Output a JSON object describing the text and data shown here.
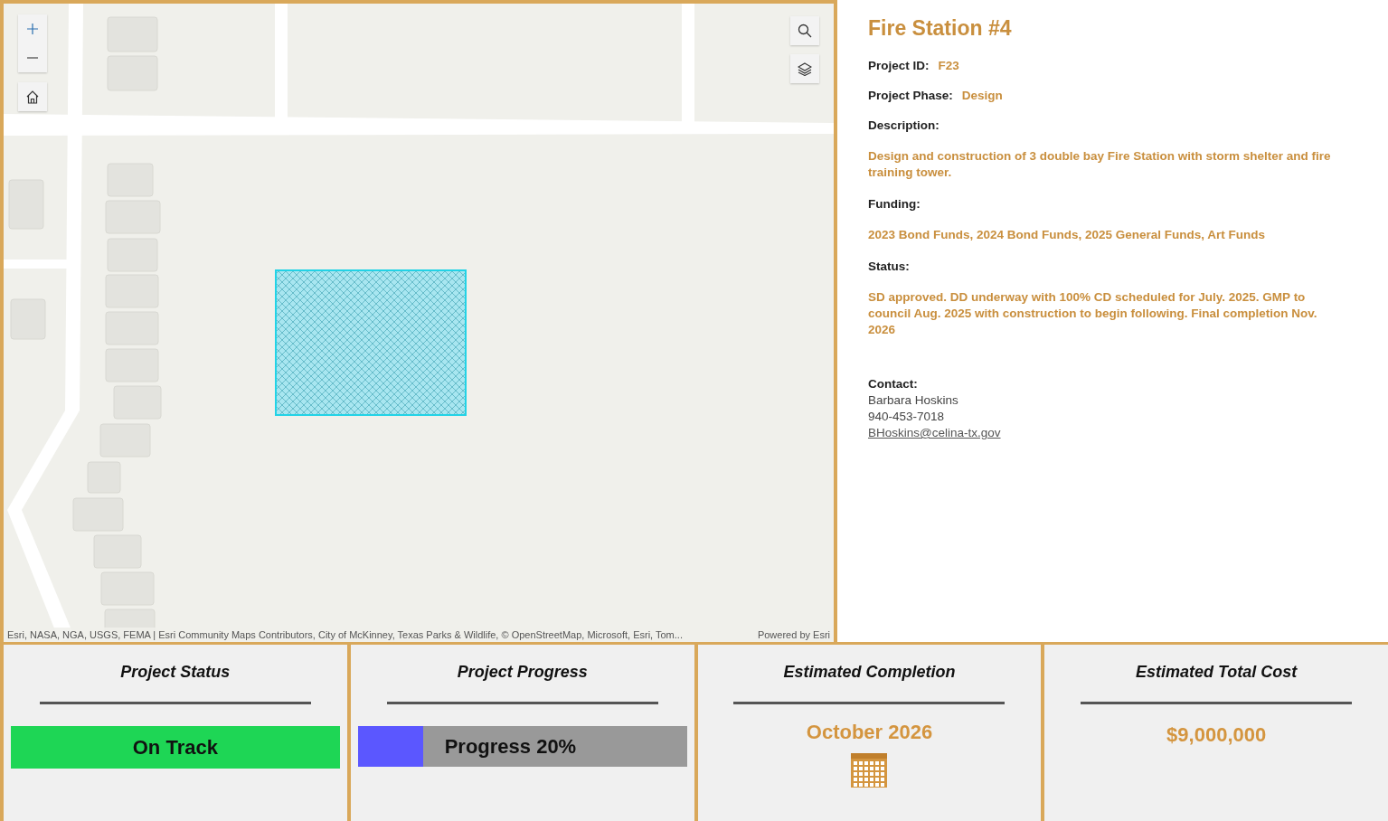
{
  "map": {
    "attribution": "Esri, NASA, NGA, USGS, FEMA | Esri Community Maps Contributors, City of McKinney, Texas Parks & Wildlife, © OpenStreetMap, Microsoft, Esri, Tom...",
    "powered_by": "Powered by Esri"
  },
  "details": {
    "title": "Fire Station #4",
    "fields": [
      {
        "kind": "inline",
        "label": "Project ID:",
        "value": "F23"
      },
      {
        "kind": "inline",
        "label": "Project Phase:",
        "value": "Design"
      },
      {
        "kind": "block",
        "label": "Description:",
        "value": "Design and construction of 3 double bay Fire Station with storm shelter and fire training tower."
      },
      {
        "kind": "block",
        "label": "Funding:",
        "value": "2023 Bond Funds, 2024 Bond Funds, 2025 General Funds, Art Funds"
      },
      {
        "kind": "block",
        "label": "Status:",
        "value": "SD approved. DD underway with 100% CD scheduled for July. 2025. GMP to council Aug. 2025 with construction to begin following. Final completion Nov. 2026"
      }
    ],
    "contact": {
      "label": "Contact:",
      "name": "Barbara Hoskins",
      "phone": "940-453-7018",
      "email": "BHoskins@celina-tx.gov"
    }
  },
  "cards": [
    {
      "kind": "status",
      "title": "Project Status",
      "value": "On Track",
      "color": "#1ed655"
    },
    {
      "kind": "progress",
      "title": "Project Progress",
      "value": "Progress 20%",
      "level": 0.2
    },
    {
      "kind": "date",
      "title": "Estimated Completion",
      "value": "October 2026"
    },
    {
      "kind": "money",
      "title": "Estimated Total Cost",
      "value": "$9,000,000"
    }
  ]
}
